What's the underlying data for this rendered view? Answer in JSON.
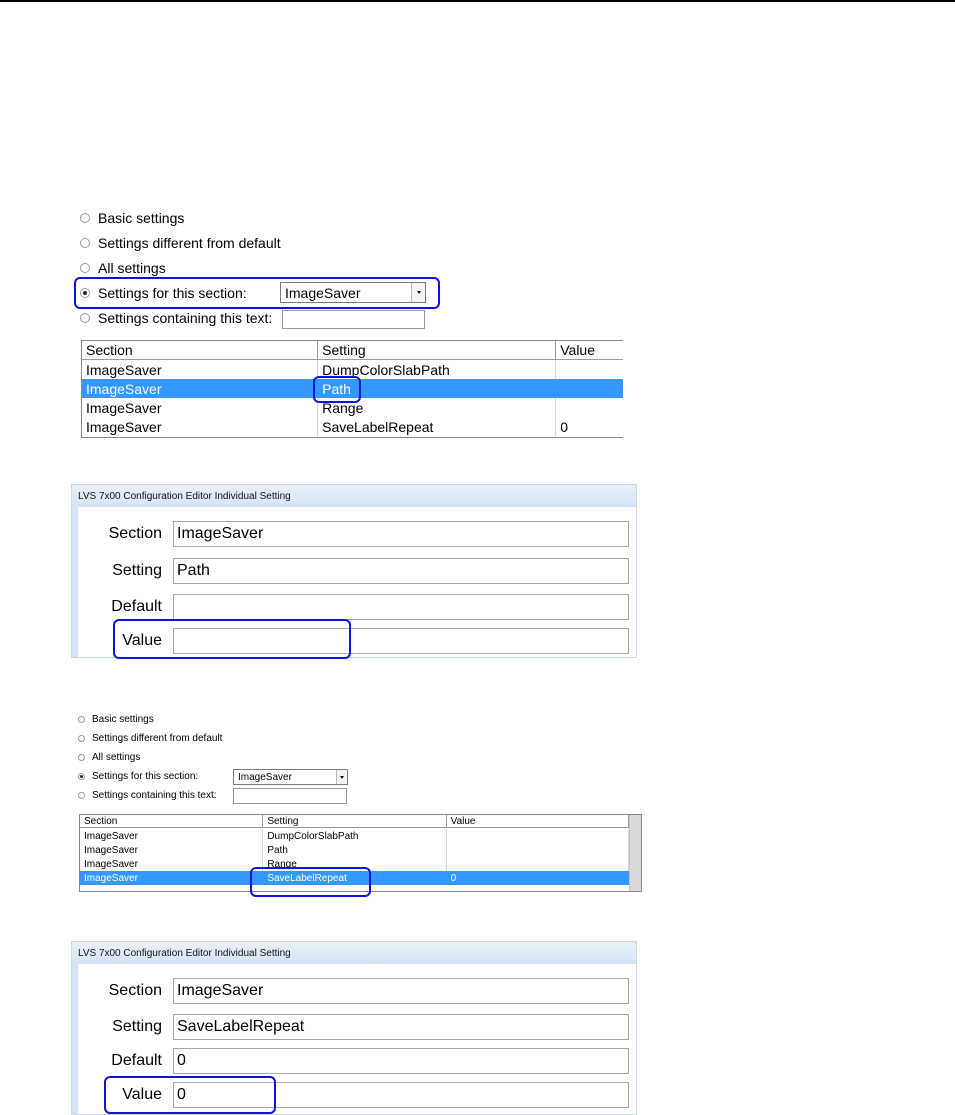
{
  "panel1": {
    "radios": [
      {
        "label": "Basic settings",
        "checked": false
      },
      {
        "label": "Settings different from default",
        "checked": false
      },
      {
        "label": "All settings",
        "checked": false
      },
      {
        "label": "Settings for this section:",
        "checked": true
      },
      {
        "label": "Settings containing this text:",
        "checked": false
      }
    ],
    "section_combo_value": "ImageSaver",
    "grid": {
      "columns": [
        "Section",
        "Setting",
        "Value"
      ],
      "rows": [
        [
          "ImageSaver",
          "DumpColorSlabPath",
          ""
        ],
        [
          "ImageSaver",
          "Path",
          ""
        ],
        [
          "ImageSaver",
          "Range",
          ""
        ],
        [
          "ImageSaver",
          "SaveLabelRepeat",
          "0"
        ]
      ],
      "selected_row": 1
    }
  },
  "dialog1": {
    "title": "LVS 7x00 Configuration Editor Individual Setting",
    "fields": [
      {
        "label": "Section",
        "value": "ImageSaver"
      },
      {
        "label": "Setting",
        "value": "Path"
      },
      {
        "label": "Default",
        "value": ""
      },
      {
        "label": "Value",
        "value": ""
      }
    ]
  },
  "panel2": {
    "radios": [
      {
        "label": "Basic settings",
        "checked": false
      },
      {
        "label": "Settings different from default",
        "checked": false
      },
      {
        "label": "All settings",
        "checked": false
      },
      {
        "label": "Settings for this section:",
        "checked": true
      },
      {
        "label": "Settings containing this text:",
        "checked": false
      }
    ],
    "section_combo_value": "ImageSaver",
    "grid": {
      "columns": [
        "Section",
        "Setting",
        "Value"
      ],
      "rows": [
        [
          "ImageSaver",
          "DumpColorSlabPath",
          ""
        ],
        [
          "ImageSaver",
          "Path",
          ""
        ],
        [
          "ImageSaver",
          "Range",
          ""
        ],
        [
          "ImageSaver",
          "SaveLabelRepeat",
          "0"
        ]
      ],
      "selected_row": 3
    }
  },
  "dialog2": {
    "title": "LVS 7x00 Configuration Editor Individual Setting",
    "fields": [
      {
        "label": "Section",
        "value": "ImageSaver"
      },
      {
        "label": "Setting",
        "value": "SaveLabelRepeat"
      },
      {
        "label": "Default",
        "value": "0"
      },
      {
        "label": "Value",
        "value": "0"
      }
    ]
  },
  "colors": {
    "selection": "#3399ff",
    "highlight": "#1212e0",
    "titlebar": "#d4e3f4"
  }
}
